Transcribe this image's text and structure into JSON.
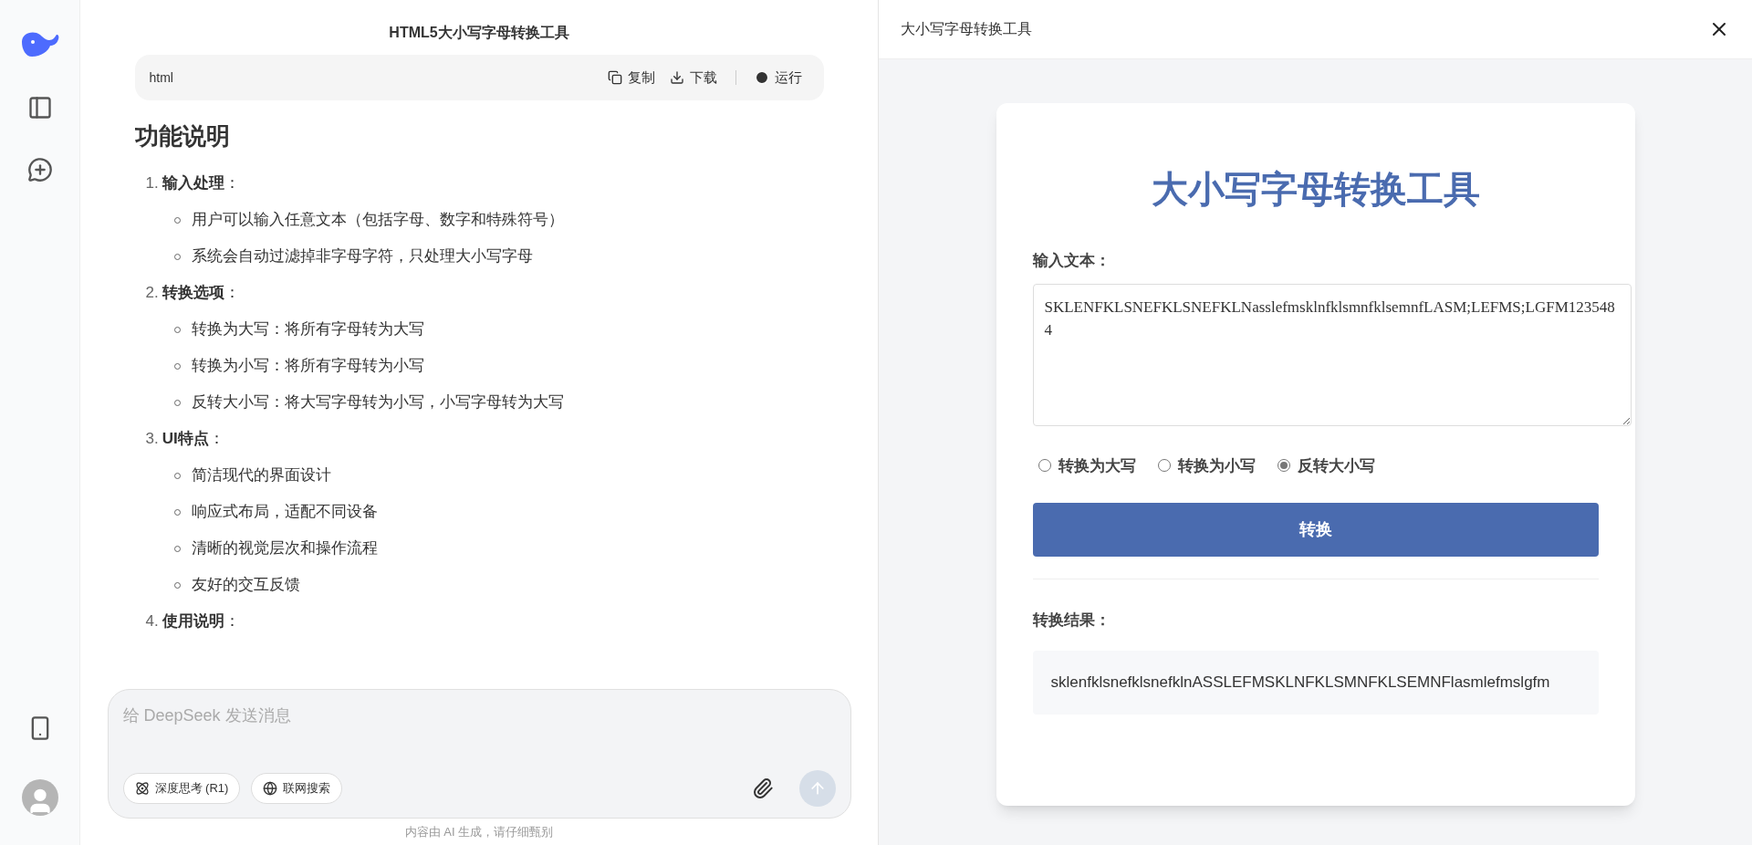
{
  "chat": {
    "title": "HTML5大小写字母转换工具",
    "code_block": {
      "language": "html",
      "actions": [
        {
          "kind": "copy",
          "label": "复制"
        },
        {
          "kind": "download",
          "label": "下载"
        },
        {
          "kind": "run",
          "label": "运行"
        }
      ]
    },
    "heading": "功能说明",
    "sections": [
      {
        "number": "1.",
        "title": "**输入处理**：",
        "items": [
          "用户可以输入任意文本（包括字母、数字和特殊符号）",
          "系统会自动过滤掉非字母字符，只处理大小写字母"
        ]
      },
      {
        "number": "2.",
        "title": "**转换选项**：",
        "items": [
          "转换为大写：将所有字母转为大写",
          "转换为小写：将所有字母转为小写",
          "反转大小写：将大写字母转为小写，小写字母转为大写"
        ]
      },
      {
        "number": "3.",
        "title": "**UI特点**：",
        "items": [
          "简洁现代的界面设计",
          "响应式布局，适配不同设备",
          "清晰的视觉层次和操作流程",
          "友好的交互反馈"
        ]
      },
      {
        "number": "4.",
        "title": "**使用说明**："
      }
    ],
    "composer": {
      "placeholder": "给 DeepSeek 发送消息",
      "toggles": [
        {
          "kind": "think",
          "label": "深度思考 (R1)",
          "on": false
        },
        {
          "kind": "search",
          "label": "联网搜索",
          "on": false
        }
      ]
    },
    "disclaimer": "内容由 AI 生成，请仔细甄别"
  },
  "preview": {
    "title": "大小写字母转换工具",
    "app": {
      "title": "大小写字母转换工具",
      "input_label": "输入文本：",
      "input_value": "SKLENFKLSNEFKLSNEFKLNasslefmsklnfklsmnfklsemnfLASM;LEFMS;LGFM1235484",
      "options": [
        {
          "label": "转换为大写",
          "selected": false
        },
        {
          "label": "转换为小写",
          "selected": false
        },
        {
          "label": "反转大小写",
          "selected": true
        }
      ],
      "button": "转换",
      "result_label": "转换结果：",
      "result": "sklenfklsnefklsnefklnASSLEFMSKLNFKLSMNFKLSEMNFlasmlefmslgfm"
    }
  }
}
